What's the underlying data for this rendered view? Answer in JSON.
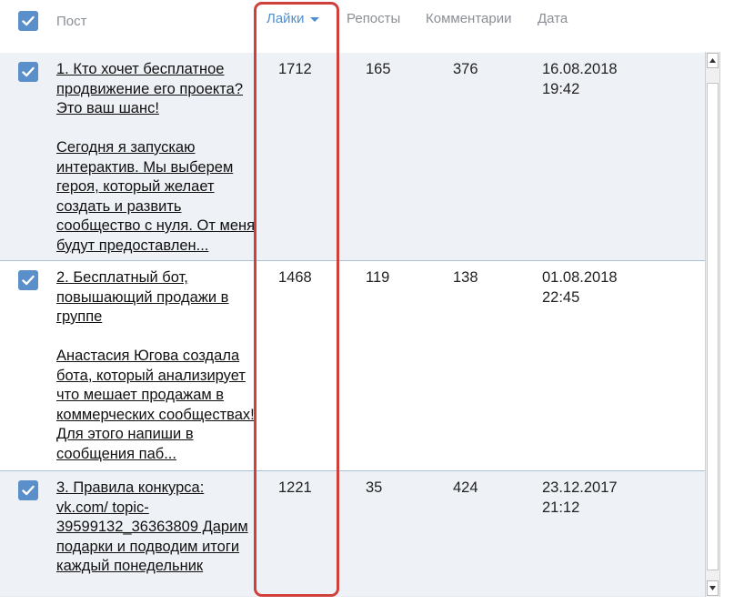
{
  "header": {
    "columns": {
      "post": "Пост",
      "likes": "Лайки",
      "reposts": "Репосты",
      "comments": "Комментарии",
      "date": "Дата"
    },
    "sorted_by": "Лайки",
    "sort_icon": "caret-down-icon"
  },
  "rows": [
    {
      "title": "1.      Кто хочет бесплатное продвижение его проекта? Это ваш шанс!",
      "body": "Сегодня я запускаю интерактив. Мы выберем героя, который желает создать и развить сообщество с нуля. От меня будут предоставлен...",
      "likes": "1712",
      "reposts": "165",
      "comments": "376",
      "date": "16.08.2018\n19:42",
      "checked": true
    },
    {
      "title": "2.      Бесплатный бот, повышающий продажи в группе",
      "body": "Анастасия Югова создала бота, который анализирует что мешает продажам в коммерческих сообществах! Для этого напиши в сообщения паб...",
      "likes": "1468",
      "reposts": "119",
      "comments": "138",
      "date": "01.08.2018\n22:45",
      "checked": true
    },
    {
      "title": "3.      Правила конкурса: vk.com/ topic-39599132_36363809      Дарим подарки и подводим итоги каждый понедельник",
      "body": "",
      "likes": "1221",
      "reposts": "35",
      "comments": "424",
      "date": "23.12.2017\n21:12",
      "checked": true
    }
  ],
  "colors": {
    "row_highlight": "#eef1f5",
    "checkbox": "#5b8fc9",
    "active_header": "#4f8fd1",
    "annotation": "#d0403a"
  }
}
